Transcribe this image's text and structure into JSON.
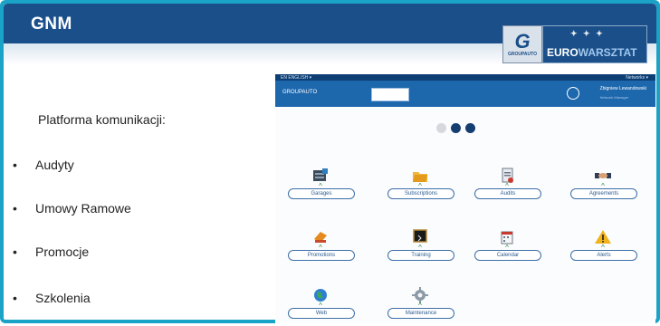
{
  "slide": {
    "title": "GNM",
    "brand": {
      "logo_letter": "G",
      "logo_caption": "GROUPAUTO",
      "name_part1": "EURO",
      "name_part2": "WARSZTAT"
    },
    "bullets": {
      "intro": "Platforma komunikacji:",
      "items": [
        "Audyty",
        "Umowy Ramowe",
        "Promocje",
        "Szkolenia"
      ]
    }
  },
  "portal": {
    "topbar_left": "EN  ENGLISH  ▾",
    "topbar_right": "Networks  ▾",
    "logo_text": "GROUPAUTO",
    "user_name": "Zbigniew Lewandowski",
    "user_role": "Network Manager",
    "tiles": [
      {
        "label": "Garages",
        "icon": "garage-icon"
      },
      {
        "label": "Subscriptions",
        "icon": "folder-icon"
      },
      {
        "label": "Audits",
        "icon": "audit-document-icon"
      },
      {
        "label": "Agreements",
        "icon": "handshake-icon"
      },
      {
        "label": "Promotions",
        "icon": "promotion-icon"
      },
      {
        "label": "Training",
        "icon": "blackboard-icon"
      },
      {
        "label": "Calendar",
        "icon": "calendar-icon"
      },
      {
        "label": "Alerts",
        "icon": "warning-icon"
      },
      {
        "label": "Web",
        "icon": "globe-icon"
      },
      {
        "label": "Maintenance",
        "icon": "gear-icon"
      }
    ]
  },
  "colors": {
    "accent": "#1b4f8a",
    "frame": "#1aa3c6",
    "portal_header": "#1d67ad"
  }
}
